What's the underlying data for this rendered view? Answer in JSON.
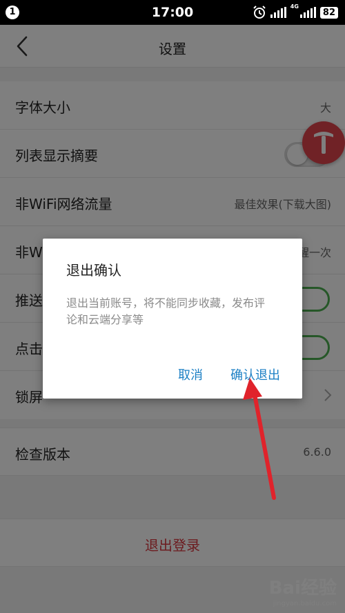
{
  "status_bar": {
    "notification_count": "1",
    "time": "17:00",
    "network_tag": "4G",
    "battery": "82"
  },
  "header": {
    "title": "设置"
  },
  "settings": {
    "font_size_label": "字体大小",
    "font_size_value": "大",
    "summary_label": "列表显示摘要",
    "summary_on": false,
    "nonwifi_traffic_label": "非WiFi网络流量",
    "nonwifi_traffic_value": "最佳效果(下载大图)",
    "nonwifi_row2_label": "非W",
    "nonwifi_row2_value": "提醒一次",
    "push_label": "推送",
    "push_on": true,
    "click_label": "点击",
    "click_on": true,
    "lockscreen_label": "锁屏"
  },
  "version": {
    "label": "检查版本",
    "value": "6.6.0"
  },
  "logout": {
    "label": "退出登录"
  },
  "dialog": {
    "title": "退出确认",
    "message": "退出当前账号，将不能同步收藏，发布评论和云端分享等",
    "cancel_label": "取消",
    "confirm_label": "确认退出"
  },
  "watermark": {
    "logo": "Bai经验",
    "url": "jingyan.baidu.com"
  },
  "colors": {
    "accent": "#1b7fc4",
    "logout_red": "#d9363e",
    "toggle_green": "#4caf50",
    "annotation_red": "#e0232b",
    "badge_red": "#e0454c"
  }
}
